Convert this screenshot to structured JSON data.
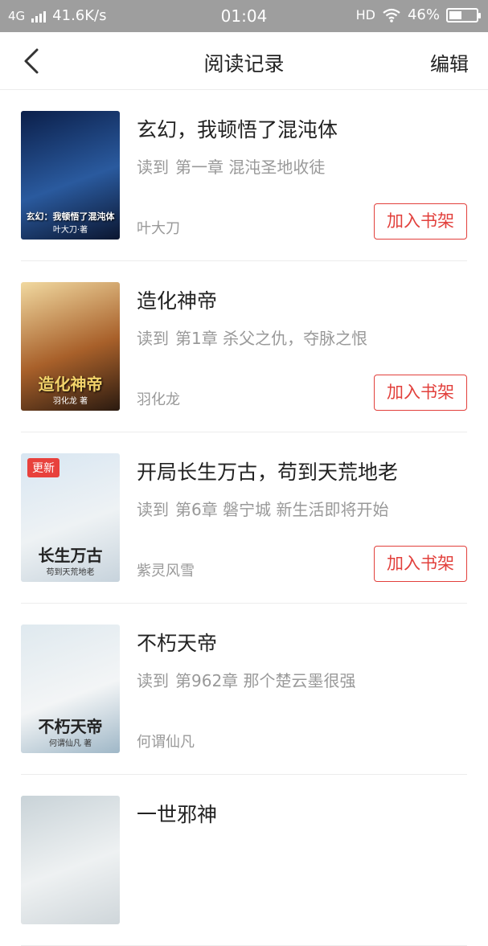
{
  "status_bar": {
    "network": "4G",
    "speed": "41.6K/s",
    "time": "01:04",
    "hd": "HD",
    "battery": "46%",
    "battery_level": 0.46
  },
  "nav": {
    "title": "阅读记录",
    "edit_label": "编辑"
  },
  "read_prefix": "读到",
  "add_shelf_label": "加入书架",
  "books": [
    {
      "title": "玄幻，我顿悟了混沌体",
      "progress": "第一章 混沌圣地收徒",
      "author": "叶大刀",
      "cover_text": "玄幻：我顿悟了混沌体",
      "cover_author": "叶大刀·著",
      "cover_colors": [
        "#0b1f4a",
        "#2a5a9e",
        "#0b1630"
      ]
    },
    {
      "title": "造化神帝",
      "progress": "第1章 杀父之仇，夺脉之恨",
      "author": "羽化龙",
      "cover_text": "造化神帝",
      "cover_author": "羽化龙 著",
      "cover_colors": [
        "#f1d9a0",
        "#a8602a",
        "#2a1a10"
      ]
    },
    {
      "title": "开局长生万古，苟到天荒地老",
      "progress": "第6章 磐宁城 新生活即将开始",
      "author": "紫灵风雪",
      "badge": "更新",
      "cover_text": "长生万古",
      "cover_author": "苟到天荒地老",
      "cover_colors": [
        "#d8e6f2",
        "#eef2f4",
        "#c7d3dc"
      ]
    },
    {
      "title": "不朽天帝",
      "progress": "第962章 那个楚云墨很强",
      "author": "何谓仙凡",
      "cover_text": "不朽天帝",
      "cover_author": "何谓仙凡 著",
      "cover_colors": [
        "#dfe9ef",
        "#f3f5f6",
        "#9fb7c7"
      ]
    },
    {
      "title": "一世邪神",
      "progress": "",
      "author": "",
      "cover_text": "",
      "cover_author": "",
      "cover_colors": [
        "#c9d3d8",
        "#eef1f2",
        "#cfd6da"
      ]
    }
  ]
}
